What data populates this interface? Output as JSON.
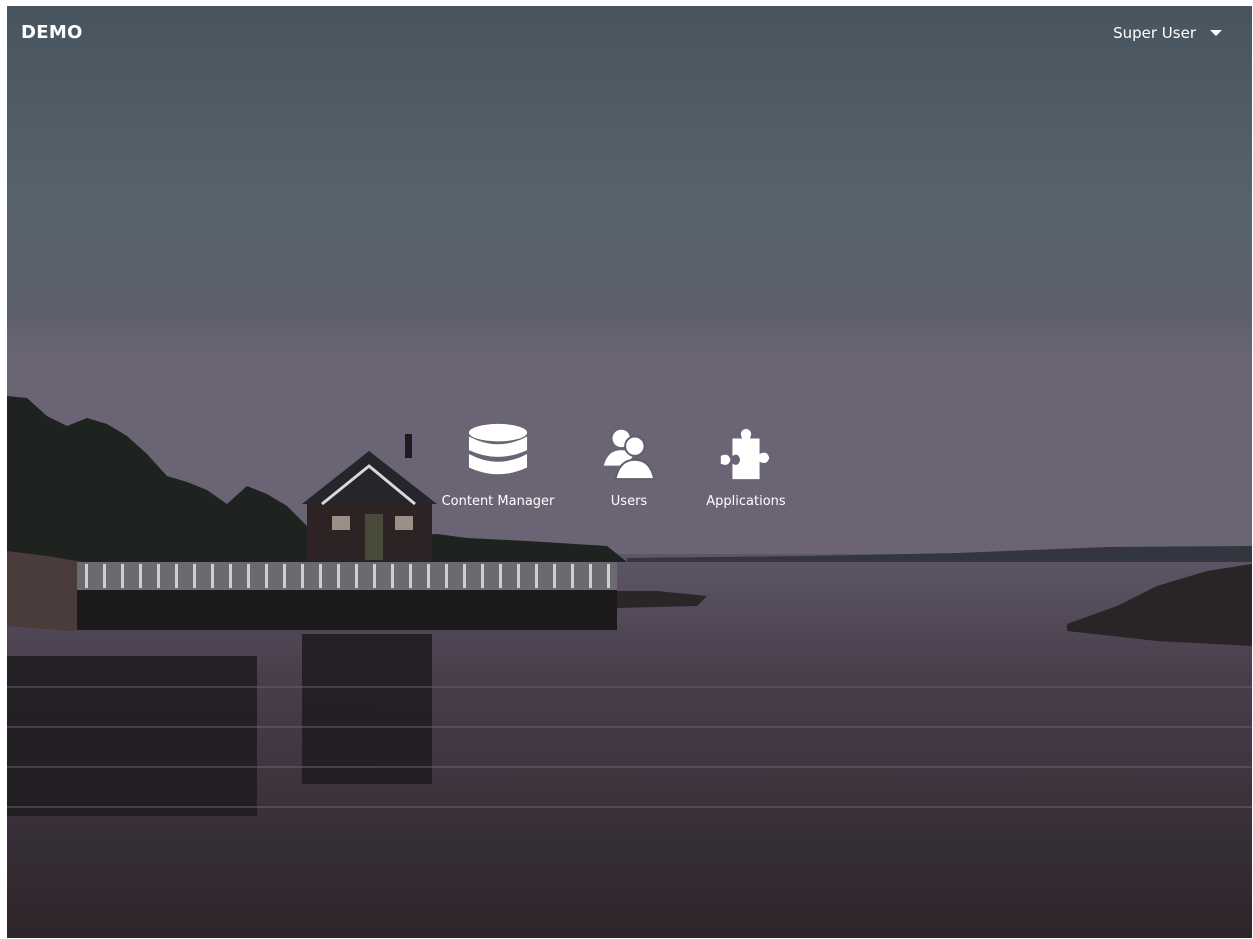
{
  "header": {
    "brand": "DEMO",
    "user_name": "Super User"
  },
  "apps": [
    {
      "label": "Content Manager",
      "icon": "database-icon"
    },
    {
      "label": "Users",
      "icon": "users-icon"
    },
    {
      "label": "Applications",
      "icon": "puzzle-icon"
    }
  ],
  "colors": {
    "sky_top": "#4a5a66",
    "sky_horizon": "#6b6473",
    "water": "#3d3440",
    "text": "#ffffff"
  }
}
